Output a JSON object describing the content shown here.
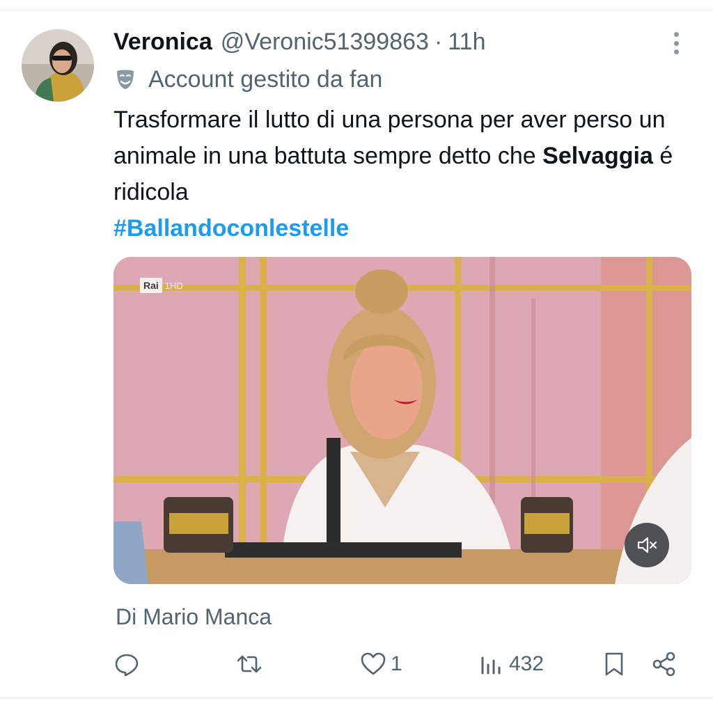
{
  "tweet": {
    "display_name": "Veronica",
    "handle": "@Veronic51399863",
    "separator": "·",
    "time": "11h",
    "account_label": "Account gestito da fan",
    "text_before_bold": "Trasformare il lutto di una persona per aver perso un animale in una battuta sempre detto che ",
    "text_bold": "Selvaggia",
    "text_after_bold": " é ridicola",
    "hashtag": "#Ballandoconlestelle",
    "byline": "Di Mario Manca"
  },
  "media": {
    "channel_logo": "Rai",
    "channel_suffix": "1HD",
    "mute_icon": "volume-muted-icon"
  },
  "actions": {
    "reply_icon": "reply-icon",
    "retweet_icon": "retweet-icon",
    "like_icon": "heart-icon",
    "like_count": "1",
    "views_icon": "views-icon",
    "views_count": "432",
    "bookmark_icon": "bookmark-icon",
    "share_icon": "share-icon"
  },
  "colors": {
    "link_blue": "#1d9bf0",
    "secondary_text": "#536471",
    "primary_text": "#0f1419"
  }
}
